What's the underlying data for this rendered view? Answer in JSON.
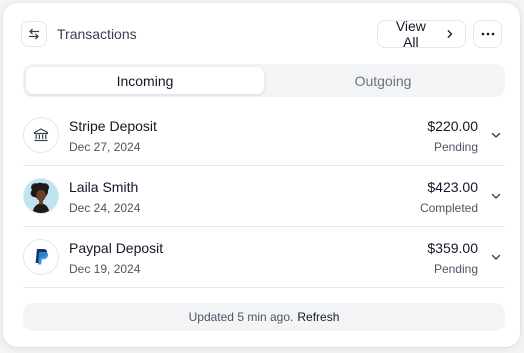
{
  "header": {
    "title": "Transactions",
    "view_all_label": "View All"
  },
  "tabs": [
    {
      "label": "Incoming",
      "active": true
    },
    {
      "label": "Outgoing",
      "active": false
    }
  ],
  "transactions": [
    {
      "name": "Stripe Deposit",
      "date": "Dec 27, 2024",
      "amount": "$220.00",
      "status": "Pending",
      "icon": "bank-icon"
    },
    {
      "name": "Laila Smith",
      "date": "Dec 24, 2024",
      "amount": "$423.00",
      "status": "Completed",
      "icon": "user-avatar"
    },
    {
      "name": "Paypal Deposit",
      "date": "Dec 19, 2024",
      "amount": "$359.00",
      "status": "Pending",
      "icon": "paypal-icon"
    }
  ],
  "footer": {
    "updated_text": "Updated 5 min ago.",
    "refresh_label": "Refresh"
  },
  "colors": {
    "background": "#f3f4f6",
    "card": "#ffffff",
    "border": "#e5e7eb",
    "text_primary": "#111827",
    "text_secondary": "#4b5563",
    "paypal_dark": "#1a2e6e",
    "paypal_light": "#2a8cd8"
  }
}
